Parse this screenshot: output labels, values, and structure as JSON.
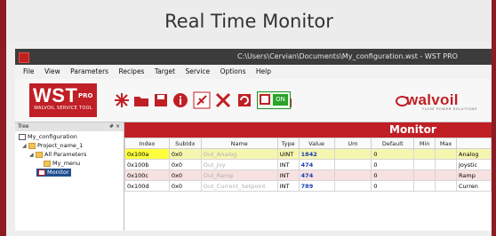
{
  "caption": "Real Time Monitor",
  "window": {
    "title": "C:\\Users\\Cervian\\Documents\\My_configuration.wst - WST PRO"
  },
  "menu": [
    "File",
    "View",
    "Parameters",
    "Recipes",
    "Target",
    "Service",
    "Options",
    "Help"
  ],
  "logo": {
    "main": "WST",
    "pro": "PRO",
    "sub": "WALVOIL SERVICE TOOL"
  },
  "toolbar": {
    "on_label": "ON",
    "icons": [
      "new-star-icon",
      "open-folder-icon",
      "save-disk-icon",
      "info-icon",
      "connect-icon",
      "tools-icon",
      "refresh-icon",
      "download-icon",
      "upload-icon",
      "monitor-icon"
    ]
  },
  "brand": {
    "name": "walvoil",
    "tagline": "FLUID POWER SOLUTIONS"
  },
  "tree": {
    "header": "Tree",
    "controls": "# ×",
    "nodes": [
      {
        "label": "My_configuration",
        "level": 0
      },
      {
        "label": "Project_name_1",
        "level": 1
      },
      {
        "label": "All Parameters",
        "level": 2
      },
      {
        "label": "My_menu",
        "level": 3
      },
      {
        "label": "Monitor",
        "level": 2,
        "selected": true
      }
    ]
  },
  "monitor": {
    "title": "Monitor",
    "columns": [
      "Index",
      "SubIdx",
      "Name",
      "Type",
      "Value",
      "Um",
      "Default",
      "Min",
      "Max",
      ""
    ],
    "rows": [
      [
        "0x100a",
        "0x0",
        "Out_Analog",
        "UINT",
        "1842",
        "",
        "0",
        "",
        "",
        "Analog"
      ],
      [
        "0x100b",
        "0x0",
        "Out_Joy",
        "INT",
        "474",
        "",
        "0",
        "",
        "",
        "Joystic"
      ],
      [
        "0x100c",
        "0x0",
        "Out_Ramp",
        "INT",
        "474",
        "",
        "0",
        "",
        "",
        "Ramp"
      ],
      [
        "0x100d",
        "0x0",
        "Out_Current_Setpoint",
        "INT",
        "789",
        "",
        "0",
        "",
        "",
        "Curren"
      ]
    ]
  },
  "colors": {
    "accent_red": "#c01f25",
    "highlight_yellow": "#ffff3c",
    "value_blue": "#1a3fb0"
  }
}
